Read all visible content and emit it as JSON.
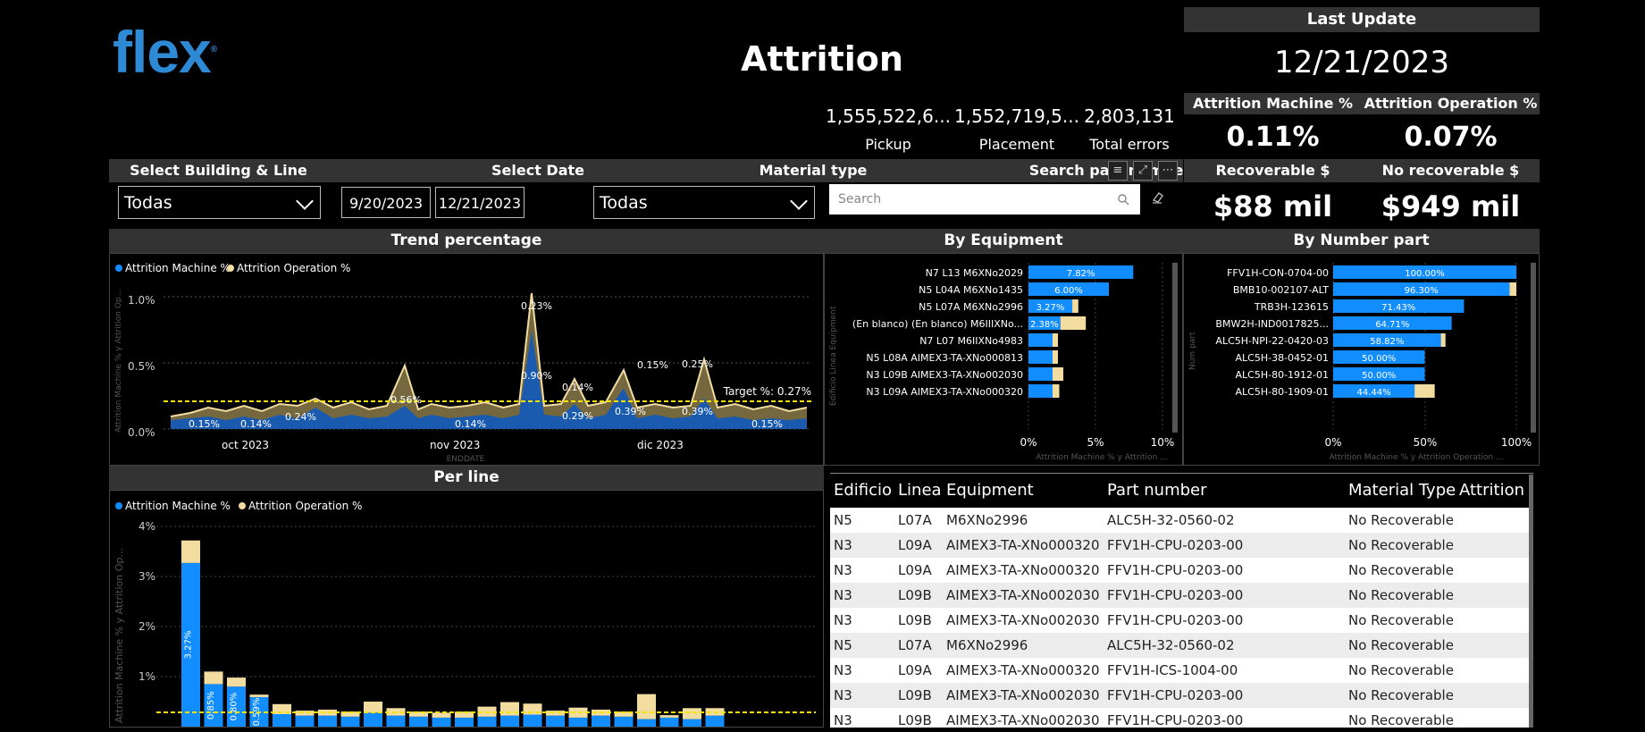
{
  "header": {
    "logo": "flex",
    "title": "Attrition",
    "last_update_label": "Last Update",
    "last_update_value": "12/21/2023"
  },
  "kpis": [
    {
      "value": "1,555,522,6...",
      "label": "Pickup"
    },
    {
      "value": "1,552,719,5...",
      "label": "Placement"
    },
    {
      "value": "2,803,131",
      "label": "Total errors"
    }
  ],
  "attrition": {
    "machine_label": "Attrition Machine %",
    "machine_value": "0.11%",
    "operation_label": "Attrition Operation %",
    "operation_value": "0.07%"
  },
  "recoverable": {
    "rec_label": "Recoverable $",
    "rec_value": "$88 mil",
    "norec_label": "No recoverable $",
    "norec_value": "$949 mil"
  },
  "filters": {
    "building_label": "Select Building & Line",
    "building_value": "Todas",
    "date_label": "Select Date",
    "date_from": "9/20/2023",
    "date_to": "12/21/2023",
    "material_label": "Material type",
    "material_value": "Todas",
    "search_label": "Search part number",
    "search_placeholder": "Search"
  },
  "colors": {
    "machine": "#118DFF",
    "operation": "#F2DCA0",
    "target": "#F5E400",
    "brand": "#2F8AD6"
  },
  "trend": {
    "title": "Trend percentage",
    "legend": [
      "Attrition Machine %",
      "Attrition Operation %"
    ],
    "yticks": [
      "1.0%",
      "0.5%",
      "0.0%"
    ],
    "xticks": [
      "oct 2023",
      "nov 2023",
      "dic 2023"
    ],
    "xlabel": "ENDDATE",
    "ylabel": "Attrition Machine % y Attrition Op...",
    "target_label": "Target %: 0.27%",
    "labels": [
      "0.15%",
      "0.14%",
      "0.24%",
      "0.56%",
      "0.14%",
      "0.23%",
      "0.90%",
      "0.14%",
      "0.29%",
      "0.15%",
      "0.39%",
      "0.25%",
      "0.39%",
      "0.15%"
    ]
  },
  "equipment": {
    "title": "By Equipment",
    "xticks": [
      "0%",
      "5%",
      "10%"
    ],
    "xlabel": "Attrition Machine % y Attrition ...",
    "ylabel": "Edificio Linea Equipment",
    "rows": [
      {
        "label": "N7 L13 M6XNo2029",
        "machine": 7.82,
        "operation": 0.0,
        "text": "7.82%"
      },
      {
        "label": "N5 L04A M6XNo1435",
        "machine": 6.0,
        "operation": 0.0,
        "text": "6.00%"
      },
      {
        "label": "N5 L07A M6XNo2996",
        "machine": 3.27,
        "operation": 0.45,
        "text": "3.27%"
      },
      {
        "label": "(En blanco) (En blanco) M6IIIXNo...",
        "machine": 2.38,
        "operation": 1.9,
        "text": "2.38%"
      },
      {
        "label": "N7 L07 M6IIXNo4983",
        "machine": 1.8,
        "operation": 0.4,
        "text": ""
      },
      {
        "label": "N5 L08A AIMEX3-TA-XNo000813",
        "machine": 1.8,
        "operation": 0.4,
        "text": ""
      },
      {
        "label": "N3 L09B AIMEX3-TA-XNo002030",
        "machine": 1.8,
        "operation": 0.8,
        "text": ""
      },
      {
        "label": "N3 L09A AIMEX3-TA-XNo000320",
        "machine": 1.8,
        "operation": 0.5,
        "text": ""
      }
    ]
  },
  "numberpart": {
    "title": "By Number part",
    "xticks": [
      "0%",
      "50%",
      "100%"
    ],
    "xlabel": "Attrition Machine % y Attrition Operation ...",
    "ylabel": "Num part",
    "rows": [
      {
        "label": "FFV1H-CON-0704-00",
        "machine": 100.0,
        "operation": 0.0,
        "text": "100.00%"
      },
      {
        "label": "BMB10-002107-ALT",
        "machine": 96.3,
        "operation": 3.7,
        "text": "96.30%"
      },
      {
        "label": "TRB3H-123615",
        "machine": 71.43,
        "operation": 0.0,
        "text": "71.43%"
      },
      {
        "label": "BMW2H-IND0017825...",
        "machine": 64.71,
        "operation": 0.0,
        "text": "64.71%"
      },
      {
        "label": "ALC5H-NPI-22-0420-03",
        "machine": 58.82,
        "operation": 2.5,
        "text": "58.82%"
      },
      {
        "label": "ALC5H-38-0452-01",
        "machine": 50.0,
        "operation": 0.0,
        "text": "50.00%"
      },
      {
        "label": "ALC5H-80-1912-01",
        "machine": 50.0,
        "operation": 0.0,
        "text": "50.00%"
      },
      {
        "label": "ALC5H-80-1909-01",
        "machine": 44.44,
        "operation": 11.0,
        "text": "44.44%"
      }
    ]
  },
  "perline": {
    "title": "Per line",
    "legend": [
      "Attrition Machine %",
      "Attrition Operation %"
    ],
    "yticks": [
      "4%",
      "3%",
      "2%",
      "1%"
    ],
    "ylabel": "Attrition Machine % y Attrition Op...",
    "machine": [
      3.27,
      0.85,
      0.8,
      0.59,
      0.25,
      0.22,
      0.22,
      0.2,
      0.28,
      0.22,
      0.2,
      0.18,
      0.18,
      0.2,
      0.22,
      0.24,
      0.22,
      0.18,
      0.22,
      0.2,
      0.15,
      0.18,
      0.15,
      0.22
    ],
    "operation": [
      0.45,
      0.25,
      0.18,
      0.05,
      0.2,
      0.1,
      0.12,
      0.1,
      0.22,
      0.15,
      0.1,
      0.1,
      0.12,
      0.2,
      0.27,
      0.22,
      0.1,
      0.2,
      0.12,
      0.1,
      0.5,
      0.05,
      0.22,
      0.15
    ],
    "labels": [
      "3.27%",
      "0.85%",
      "0.80%",
      "0.59%"
    ]
  },
  "table": {
    "headers": [
      "Edificio",
      "Linea",
      "Equipment",
      "Part number",
      "Material Type",
      "Attrition M"
    ],
    "rows": [
      [
        "N5",
        "L07A",
        "M6XNo2996",
        "ALC5H-32-0560-02",
        "No Recoverable"
      ],
      [
        "N3",
        "L09A",
        "AIMEX3-TA-XNo000320",
        "FFV1H-CPU-0203-00",
        "No Recoverable"
      ],
      [
        "N3",
        "L09A",
        "AIMEX3-TA-XNo000320",
        "FFV1H-CPU-0203-00",
        "No Recoverable"
      ],
      [
        "N3",
        "L09B",
        "AIMEX3-TA-XNo002030",
        "FFV1H-CPU-0203-00",
        "No Recoverable"
      ],
      [
        "N3",
        "L09B",
        "AIMEX3-TA-XNo002030",
        "FFV1H-CPU-0203-00",
        "No Recoverable"
      ],
      [
        "N5",
        "L07A",
        "M6XNo2996",
        "ALC5H-32-0560-02",
        "No Recoverable"
      ],
      [
        "N3",
        "L09A",
        "AIMEX3-TA-XNo000320",
        "FFV1H-ICS-1004-00",
        "No Recoverable"
      ],
      [
        "N3",
        "L09B",
        "AIMEX3-TA-XNo002030",
        "FFV1H-CPU-0203-00",
        "No Recoverable"
      ],
      [
        "N3",
        "L09B",
        "AIMEX3-TA-XNo002030",
        "FFV1H-CPU-0203-00",
        "No Recoverable"
      ]
    ]
  }
}
